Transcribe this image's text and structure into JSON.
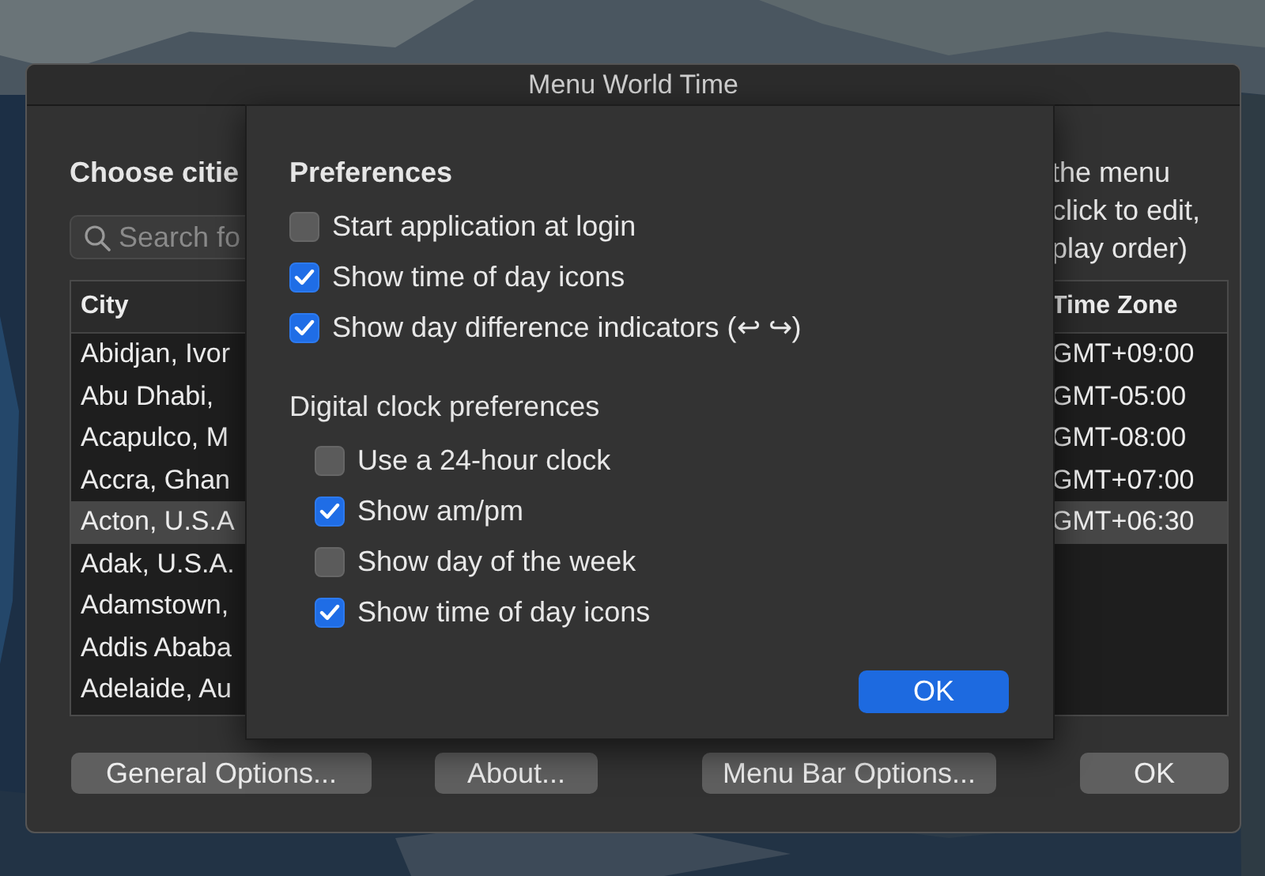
{
  "window": {
    "title": "Menu World Time"
  },
  "main": {
    "heading": "Choose citie",
    "instructions": [
      "the menu",
      "click to edit,",
      "play order)"
    ],
    "search": {
      "placeholder": "Search fo"
    },
    "table": {
      "columns": [
        "City",
        "Time Zone"
      ],
      "rows": [
        {
          "city": "Abidjan, Ivor",
          "time_zone": "GMT+09:00",
          "selected": false
        },
        {
          "city": "Abu Dhabi,",
          "time_zone": "GMT-05:00",
          "selected": false
        },
        {
          "city": "Acapulco, M",
          "time_zone": "GMT-08:00",
          "selected": false
        },
        {
          "city": "Accra, Ghan",
          "time_zone": "GMT+07:00",
          "selected": false
        },
        {
          "city": "Acton, U.S.A",
          "time_zone": "GMT+06:30",
          "selected": true
        },
        {
          "city": "Adak, U.S.A.",
          "selected": false
        },
        {
          "city": "Adamstown,",
          "selected": false
        },
        {
          "city": "Addis Ababa",
          "selected": false
        },
        {
          "city": "Adelaide, Au",
          "selected": false
        }
      ]
    }
  },
  "buttons": [
    "General Options...",
    "About...",
    "Menu Bar Options...",
    "OK"
  ],
  "sheet": {
    "title": "Preferences",
    "options": [
      {
        "label": "Start application at login",
        "checked": false
      },
      {
        "label": "Show time of day icons",
        "checked": true
      },
      {
        "label": "Show day difference indicators (↩ ↪)",
        "checked": true
      }
    ],
    "section": "Digital clock preferences",
    "clock_options": [
      {
        "label": "Use a 24-hour clock",
        "checked": false
      },
      {
        "label": "Show am/pm",
        "checked": true
      },
      {
        "label": "Show day of the week",
        "checked": false
      },
      {
        "label": "Show time of day icons",
        "checked": true
      }
    ],
    "ok": "OK"
  }
}
